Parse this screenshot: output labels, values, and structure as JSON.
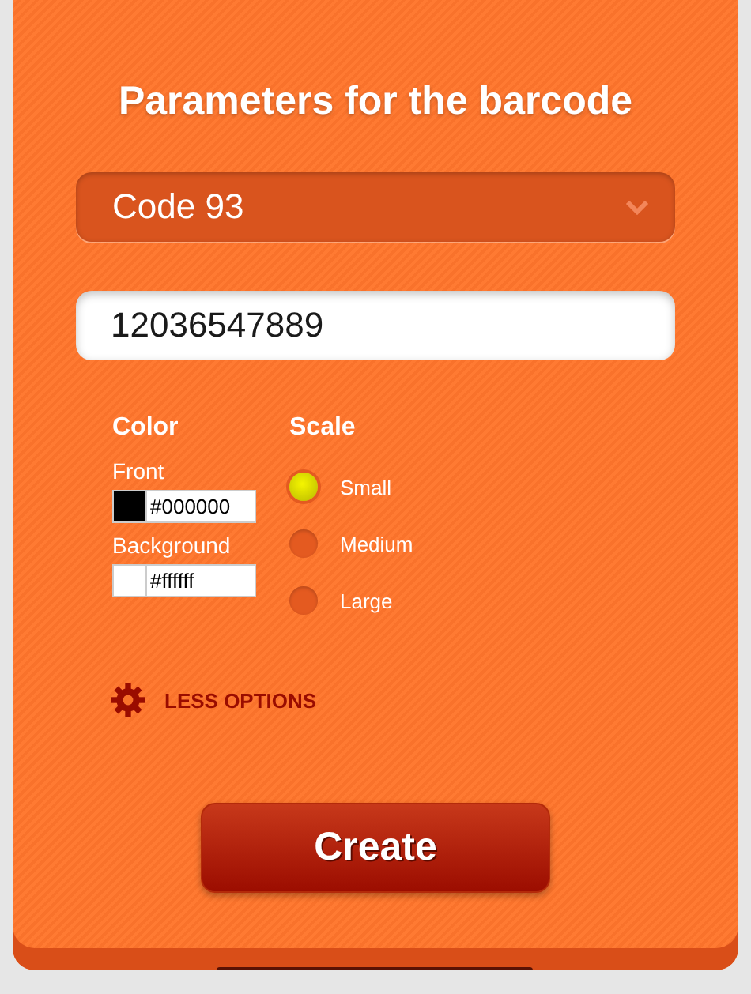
{
  "title": "Parameters for the barcode",
  "barcode_type": {
    "value": "Code 93"
  },
  "data_field": {
    "value": "12036547889"
  },
  "color": {
    "heading": "Color",
    "fields": [
      {
        "label": "Front",
        "value": "#000000",
        "color": "#000000"
      },
      {
        "label": "Background",
        "value": "#ffffff",
        "color": "#ffffff"
      }
    ]
  },
  "scale": {
    "heading": "Scale",
    "options": [
      {
        "label": "Small",
        "selected": true
      },
      {
        "label": "Medium",
        "selected": false
      },
      {
        "label": "Large",
        "selected": false
      }
    ]
  },
  "options_toggle": {
    "label": "LESS OPTIONS"
  },
  "create_button": {
    "label": "Create"
  }
}
